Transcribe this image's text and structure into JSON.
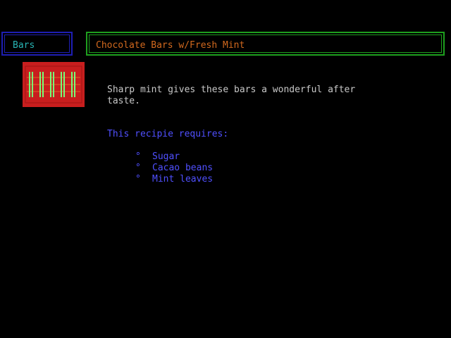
{
  "category": {
    "label": "Bars"
  },
  "recipe": {
    "title": "Chocolate Bars w/Fresh Mint",
    "description": "Sharp mint gives these bars a wonderful after\ntaste.",
    "icon": "chocolate-bar-icon",
    "requires_heading": "This recipie requires:",
    "ingredients": [
      {
        "bullet": "°",
        "name": "Sugar"
      },
      {
        "bullet": "°",
        "name": "Cacao beans"
      },
      {
        "bullet": "°",
        "name": "Mint leaves"
      }
    ]
  },
  "colors": {
    "background": "#000000",
    "category_border": "#1e1eb4",
    "category_text": "#28b4b4",
    "title_border": "#1ea01e",
    "title_text": "#d2691e",
    "body_text": "#c8c8c8",
    "list_text": "#5050ff",
    "icon_fill": "#c81e1e",
    "icon_stripes": "#78ff78"
  }
}
